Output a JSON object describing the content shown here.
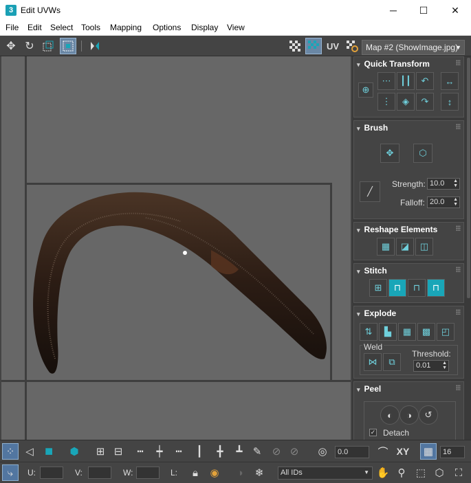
{
  "window": {
    "app_icon_text": "3",
    "title": "Edit UVWs",
    "minimize": "─",
    "maximize": "☐",
    "close": "✕"
  },
  "menu": [
    "File",
    "Edit",
    "Select",
    "Tools",
    "Mapping",
    "Options",
    "Display",
    "View"
  ],
  "toolbar": {
    "uv_label": "UV",
    "map_select": "Map #2 (ShowImage.jpg)"
  },
  "rollouts": {
    "quick_transform": "Quick Transform",
    "brush": "Brush",
    "strength_label": "Strength:",
    "strength_value": "10.0",
    "falloff_label": "Falloff:",
    "falloff_value": "20.0",
    "reshape": "Reshape Elements",
    "stitch": "Stitch",
    "explode": "Explode",
    "weld_label": "Weld",
    "threshold_label": "Threshold:",
    "threshold_value": "0.01",
    "peel": "Peel",
    "detach_label": "Detach"
  },
  "bottom": {
    "angle_value": "0.0",
    "xy_label": "XY",
    "grid_value": "16",
    "u_label": "U:",
    "v_label": "V:",
    "w_label": "W:",
    "l_label": "L:",
    "ids_select": "All IDs"
  },
  "colors": {
    "accent_teal": "#19a6b8",
    "active_blue": "#6a87a5",
    "viewport_gray": "#676767",
    "panel_dark": "#3a3a3a"
  }
}
